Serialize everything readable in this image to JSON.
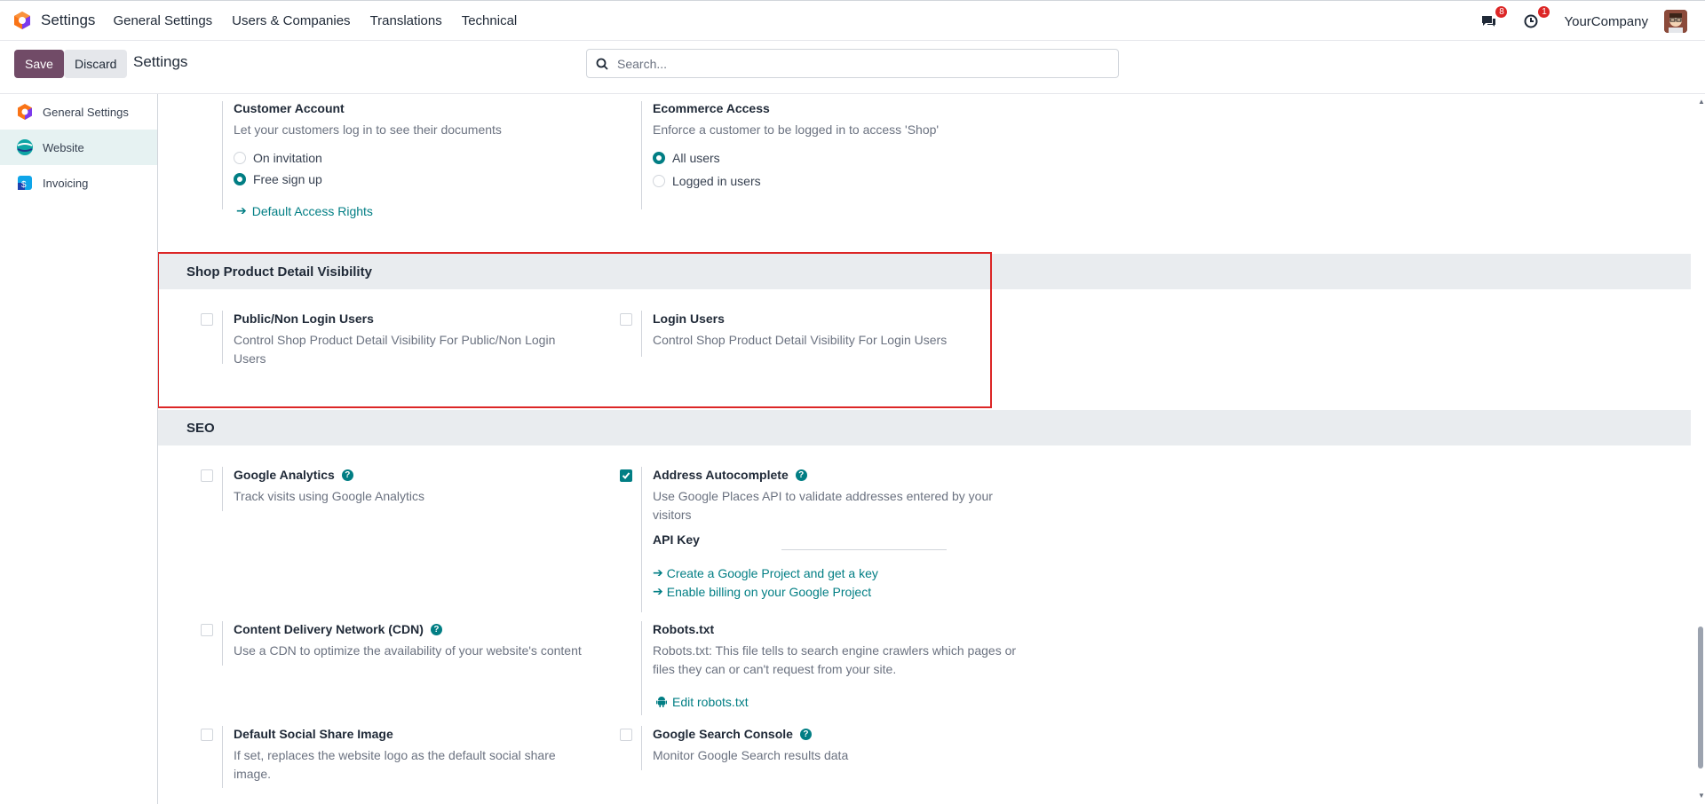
{
  "navbar": {
    "app_name": "Settings",
    "menu": [
      "General Settings",
      "Users & Companies",
      "Translations",
      "Technical"
    ],
    "messages_count": "8",
    "activities_count": "1",
    "company": "YourCompany"
  },
  "control_panel": {
    "save_label": "Save",
    "discard_label": "Discard",
    "breadcrumb": "Settings",
    "search_placeholder": "Search..."
  },
  "sidebar": {
    "items": [
      {
        "label": "General Settings",
        "icon": "odoo-settings-icon",
        "active": false
      },
      {
        "label": "Website",
        "icon": "website-icon",
        "active": true
      },
      {
        "label": "Invoicing",
        "icon": "invoicing-icon",
        "active": false
      }
    ]
  },
  "customer_account": {
    "title": "Customer Account",
    "desc": "Let your customers log in to see their documents",
    "options": [
      "On invitation",
      "Free sign up"
    ],
    "selected": "Free sign up",
    "link": "Default Access Rights"
  },
  "ecommerce_access": {
    "title": "Ecommerce Access",
    "desc": "Enforce a customer to be logged in to access 'Shop'",
    "options": [
      "All users",
      "Logged in users"
    ],
    "selected": "All users"
  },
  "shop_visibility": {
    "header": "Shop Product Detail Visibility",
    "public": {
      "title": "Public/Non Login Users",
      "desc": "Control Shop Product Detail Visibility For Public/Non Login Users",
      "checked": false
    },
    "login": {
      "title": "Login Users",
      "desc": "Control Shop Product Detail Visibility For Login Users",
      "checked": false
    }
  },
  "seo": {
    "header": "SEO",
    "google_analytics": {
      "title": "Google Analytics",
      "desc": "Track visits using Google Analytics",
      "checked": false
    },
    "address_autocomplete": {
      "title": "Address Autocomplete",
      "desc": "Use Google Places API to validate addresses entered by your visitors",
      "checked": true,
      "api_key_label": "API Key",
      "links": [
        "Create a Google Project and get a key",
        "Enable billing on your Google Project"
      ]
    },
    "cdn": {
      "title": "Content Delivery Network (CDN)",
      "desc": "Use a CDN to optimize the availability of your website's content",
      "checked": false
    },
    "robots": {
      "title": "Robots.txt",
      "desc": "Robots.txt: This file tells to search engine crawlers which pages or files they can or can't request from your site.",
      "link": "Edit robots.txt"
    },
    "social_image": {
      "title": "Default Social Share Image",
      "desc": "If set, replaces the website logo as the default social share image.",
      "checked": false
    },
    "search_console": {
      "title": "Google Search Console",
      "desc": "Monitor Google Search results data",
      "checked": false
    }
  },
  "colors": {
    "accent": "#017e84",
    "primary": "#714b67",
    "highlight": "#dc2626"
  }
}
